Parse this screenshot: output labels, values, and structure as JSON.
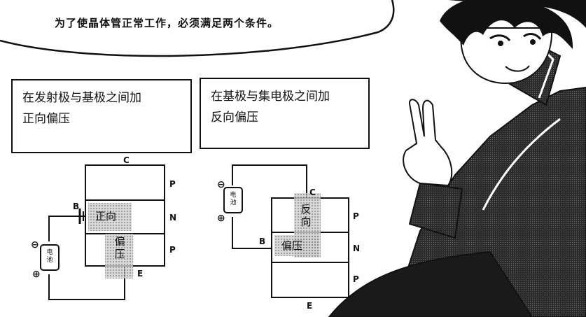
{
  "bubble": {
    "text": "为了使晶体管正常工作，必须满足两个条件。"
  },
  "left_caption": {
    "line1": "在发射极与基极之间加",
    "line2": "正向偏压"
  },
  "right_caption": {
    "line1": "在基极与集电极之间加",
    "line2": "反向偏压"
  },
  "left_diagram": {
    "label_c": "C",
    "label_b": "B",
    "label_e": "E",
    "layers": [
      "P",
      "N",
      "P"
    ],
    "shade_top": "正向",
    "shade_bottom": "偏压",
    "battery": "电池",
    "minus": "⊖",
    "plus": "⊕"
  },
  "right_diagram": {
    "label_c": "C",
    "label_b": "B",
    "label_e": "E",
    "layers": [
      "P",
      "N",
      "P"
    ],
    "shade_vertical": "反向",
    "shade_base": "偏压",
    "battery": "电池",
    "minus": "⊖",
    "plus": "⊕"
  }
}
